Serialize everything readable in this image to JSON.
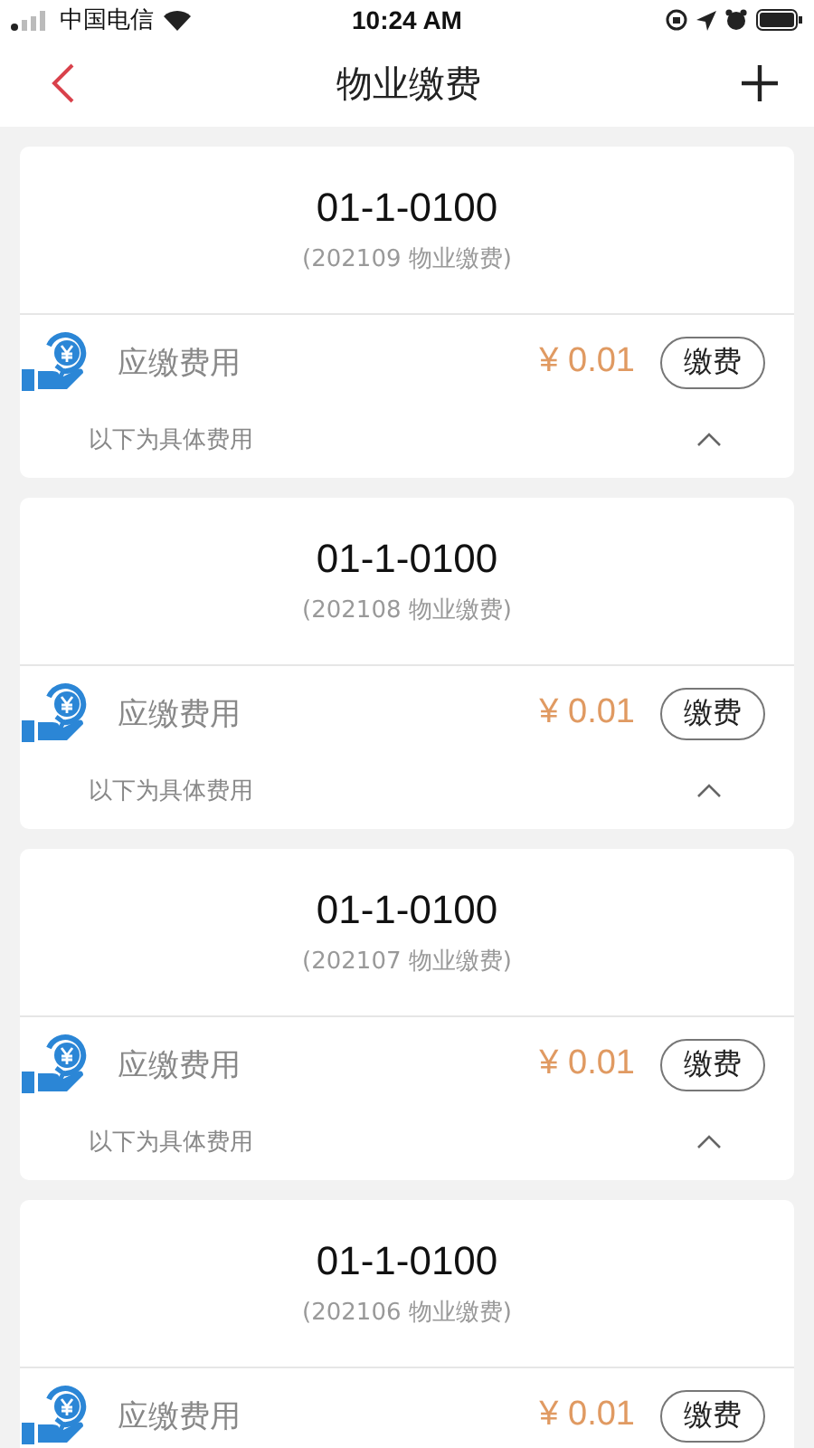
{
  "status_bar": {
    "carrier": "中国电信",
    "time": "10:24 AM"
  },
  "nav": {
    "title": "物业缴费"
  },
  "bills": [
    {
      "room": "01-1-0100",
      "period": "(202109 物业缴费)",
      "fee_label": "应缴费用",
      "amount": "¥ 0.01",
      "pay_button": "缴费",
      "detail_label": "以下为具体费用",
      "expanded": true
    },
    {
      "room": "01-1-0100",
      "period": "(202108 物业缴费)",
      "fee_label": "应缴费用",
      "amount": "¥ 0.01",
      "pay_button": "缴费",
      "detail_label": "以下为具体费用",
      "expanded": true
    },
    {
      "room": "01-1-0100",
      "period": "(202107 物业缴费)",
      "fee_label": "应缴费用",
      "amount": "¥ 0.01",
      "pay_button": "缴费",
      "detail_label": "以下为具体费用",
      "expanded": true
    },
    {
      "room": "01-1-0100",
      "period": "(202106 物业缴费)",
      "fee_label": "应缴费用",
      "amount": "¥ 0.01",
      "pay_button": "缴费"
    }
  ]
}
